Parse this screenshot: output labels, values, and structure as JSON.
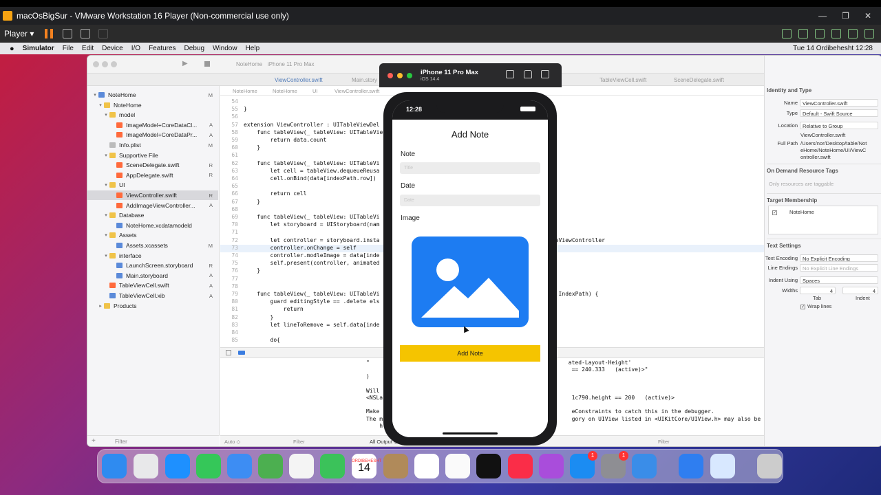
{
  "vm": {
    "title": "macOsBigSur - VMware Workstation 16 Player (Non-commercial use only)",
    "player_label": "Player",
    "win_buttons": [
      "—",
      "❐",
      "✕"
    ]
  },
  "mac_menu": {
    "app": "Simulator",
    "items": [
      "File",
      "Edit",
      "Device",
      "I/O",
      "Features",
      "Debug",
      "Window",
      "Help"
    ],
    "clock": "Tue 14 Ordibehesht  12:28"
  },
  "xcode": {
    "scheme": "NoteHome",
    "destination": "iPhone 11 Pro Max",
    "tabs": [
      "ViewController.swift",
      "Main.story",
      "TableViewCell.swift",
      "SceneDelegate.swift"
    ],
    "jump_bar": [
      "NoteHome",
      "NoteHome",
      "UI",
      "ViewController.swift"
    ],
    "navigator": [
      {
        "name": "NoteHome",
        "status": "M",
        "type": "project",
        "chev": "▾"
      },
      {
        "name": "NoteHome",
        "status": "",
        "type": "folder",
        "chev": "▾"
      },
      {
        "name": "model",
        "status": "",
        "type": "folder",
        "chev": "▾"
      },
      {
        "name": "ImageModel+CoreDataCl...",
        "status": "A",
        "type": "swift",
        "chev": ""
      },
      {
        "name": "ImageModel+CoreDataPr...",
        "status": "A",
        "type": "swift",
        "chev": ""
      },
      {
        "name": "Info.plist",
        "status": "M",
        "type": "plist",
        "chev": ""
      },
      {
        "name": "Supportive File",
        "status": "",
        "type": "folder",
        "chev": "▾"
      },
      {
        "name": "SceneDelegate.swift",
        "status": "R",
        "type": "swift",
        "chev": ""
      },
      {
        "name": "AppDelegate.swift",
        "status": "R",
        "type": "swift",
        "chev": ""
      },
      {
        "name": "UI",
        "status": "",
        "type": "folder",
        "chev": "▾"
      },
      {
        "name": "ViewController.swift",
        "status": "R",
        "type": "swift",
        "chev": "",
        "selected": true
      },
      {
        "name": "AddImageViewController...",
        "status": "A",
        "type": "swift",
        "chev": ""
      },
      {
        "name": "Database",
        "status": "",
        "type": "folder",
        "chev": "▾"
      },
      {
        "name": "NoteHome.xcdatamodeld",
        "status": "",
        "type": "xib",
        "chev": ""
      },
      {
        "name": "Assets",
        "status": "",
        "type": "folder",
        "chev": "▾"
      },
      {
        "name": "Assets.xcassets",
        "status": "M",
        "type": "xib",
        "chev": ""
      },
      {
        "name": "interface",
        "status": "",
        "type": "folder",
        "chev": "▾"
      },
      {
        "name": "LaunchScreen.storyboard",
        "status": "R",
        "type": "xib",
        "chev": ""
      },
      {
        "name": "Main.storyboard",
        "status": "A",
        "type": "xib",
        "chev": ""
      },
      {
        "name": "TableViewCell.swift",
        "status": "A",
        "type": "swift",
        "chev": ""
      },
      {
        "name": "TableViewCell.xib",
        "status": "A",
        "type": "xib",
        "chev": ""
      },
      {
        "name": "Products",
        "status": "",
        "type": "folder",
        "chev": "▸"
      }
    ],
    "filter_placeholder": "Filter",
    "code": [
      {
        "n": "54",
        "t": ""
      },
      {
        "n": "55",
        "t": "}"
      },
      {
        "n": "56",
        "t": ""
      },
      {
        "n": "57",
        "t": "extension ViewController : UITableViewDel"
      },
      {
        "n": "58",
        "t": "    func tableView(_ tableView: UITableVie"
      },
      {
        "n": "59",
        "t": "        return data.count"
      },
      {
        "n": "60",
        "t": "    }"
      },
      {
        "n": "61",
        "t": ""
      },
      {
        "n": "62",
        "t": "    func tableView(_ tableView: UITableVi                                   wCell {"
      },
      {
        "n": "63",
        "t": "        let cell = tableView.dequeueReusa"
      },
      {
        "n": "64",
        "t": "        cell.onBind(data[indexPath.row])"
      },
      {
        "n": "65",
        "t": ""
      },
      {
        "n": "66",
        "t": "        return cell"
      },
      {
        "n": "67",
        "t": "    }"
      },
      {
        "n": "68",
        "t": ""
      },
      {
        "n": "69",
        "t": "    func tableView(_ tableView: UITableVi"
      },
      {
        "n": "70",
        "t": "        let storyboard = UIStoryboard(nam"
      },
      {
        "n": "71",
        "t": ""
      },
      {
        "n": "72",
        "t": "        let controller = storyboard.insta                              ontroller\") as! AddImageViewController"
      },
      {
        "n": "73",
        "t": "        controller.onChange = self",
        "hl": true
      },
      {
        "n": "74",
        "t": "        controller.modleImage = data[inde"
      },
      {
        "n": "75",
        "t": "        self.present(controller, animated"
      },
      {
        "n": "76",
        "t": "    }"
      },
      {
        "n": "77",
        "t": ""
      },
      {
        "n": "78",
        "t": ""
      },
      {
        "n": "79",
        "t": "    func tableView(_ tableView: UITableVi                              le, forRowAt indexPath: IndexPath) {"
      },
      {
        "n": "80",
        "t": "        guard editingStyle == .delete els"
      },
      {
        "n": "81",
        "t": "            return"
      },
      {
        "n": "82",
        "t": "        }"
      },
      {
        "n": "83",
        "t": "        let lineToRemove = self.data[inde"
      },
      {
        "n": "84",
        "t": ""
      },
      {
        "n": "85",
        "t": "        do{"
      }
    ],
    "debug_lines": [
      "\"                                                            ated-Layout-Height'",
      "                                                              == 240.333   (active)>\"",
      ")",
      "",
      "Will",
      "<NSLa                                                         1c790.height == 200   (active)>",
      "",
      "Make                                                          eConstraints to catch this in the debugger.",
      "The m                                                         gory on UIView listed in <UIKitCore/UIView.h> may also be",
      "    h"
    ],
    "debug_footer": {
      "auto": "Auto ◇",
      "filter": "Filter",
      "all_output": "All Output ◇",
      "filter2": "Filter"
    },
    "inspector": {
      "identity_title": "Identity and Type",
      "name": "ViewController.swift",
      "type": "Default - Swift Source",
      "location": "Relative to Group",
      "location_file": "ViewController.swift",
      "full_path": "/Users/nor/Desktop/table/NoteHome/NoteHome/UI/ViewController.swift",
      "odr_title": "On Demand Resource Tags",
      "odr_placeholder": "Only resources are taggable",
      "tm_title": "Target Membership",
      "tm_target": "NoteHome",
      "ts_title": "Text Settings",
      "text_encoding": "No Explicit Encoding",
      "line_endings": "No Explicit Line Endings",
      "indent_using": "Spaces",
      "tab_width": "4",
      "indent_width": "4",
      "wrap": "Wrap lines",
      "labels": {
        "name": "Name",
        "type": "Type",
        "location": "Location",
        "full_path": "Full Path",
        "text_encoding": "Text Encoding",
        "line_endings": "Line Endings",
        "indent_using": "Indent Using",
        "widths": "Widths",
        "tab": "Tab",
        "indent": "Indent"
      }
    }
  },
  "simulator": {
    "device": "iPhone 11 Pro Max",
    "os": "iOS 14.4",
    "time": "12:28",
    "screen": {
      "title": "Add Note",
      "note_label": "Note",
      "note_placeholder": "Title",
      "date_label": "Date",
      "date_placeholder": "Date",
      "image_label": "Image",
      "button": "Add Note"
    }
  },
  "dock": {
    "calendar_month": "ORDIBEHESHT",
    "calendar_day": "14",
    "badges": [
      "1",
      "1"
    ],
    "colors": [
      "#2f8bf0",
      "#e8e8ea",
      "#1e90ff",
      "#35c759",
      "#3d8df3",
      "#4caf50",
      "#f4f4f4",
      "#3bc25a",
      "#ffffff",
      "#b08a5a",
      "#ffffff",
      "#fafafa",
      "#111111",
      "#fa2d48",
      "#a94ddb",
      "#1b8cf2",
      "#8e8e93",
      "#3a8de8",
      "#2f7ef0",
      "#d8e8ff",
      "#cccccc"
    ]
  }
}
